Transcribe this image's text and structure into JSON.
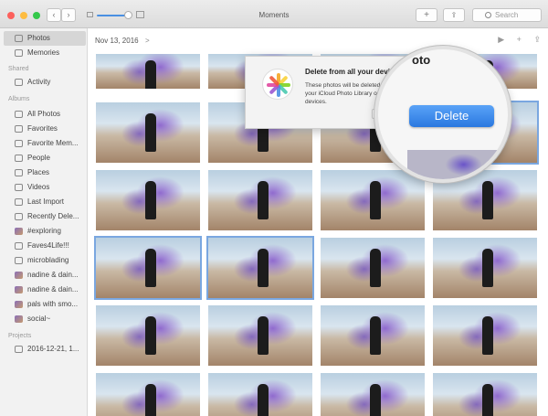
{
  "window": {
    "title": "Moments",
    "search_placeholder": "Search",
    "plus_label": "+",
    "share_label": "⇪"
  },
  "sidebar": {
    "items": [
      {
        "label": "Photos",
        "icon": "photos-icon",
        "selected": true
      },
      {
        "label": "Memories",
        "icon": "memories-icon"
      }
    ],
    "shared_header": "Shared",
    "shared": [
      {
        "label": "Activity",
        "icon": "cloud-icon"
      }
    ],
    "albums_header": "Albums",
    "albums": [
      {
        "label": "All Photos",
        "icon": "album-icon"
      },
      {
        "label": "Favorites",
        "icon": "heart-icon"
      },
      {
        "label": "Favorite Mem...",
        "icon": "heart-icon"
      },
      {
        "label": "People",
        "icon": "person-icon"
      },
      {
        "label": "Places",
        "icon": "pin-icon"
      },
      {
        "label": "Videos",
        "icon": "video-icon"
      },
      {
        "label": "Last Import",
        "icon": "clock-icon"
      },
      {
        "label": "Recently Dele...",
        "icon": "trash-icon"
      },
      {
        "label": "#exploring",
        "icon": "album-thumb-icon"
      },
      {
        "label": "Faves4Life!!!",
        "icon": "album-icon"
      },
      {
        "label": "microblading",
        "icon": "album-icon"
      },
      {
        "label": "nadine & dain...",
        "icon": "album-thumb-icon"
      },
      {
        "label": "nadine & dain...",
        "icon": "album-thumb-icon"
      },
      {
        "label": "pals with smo...",
        "icon": "album-thumb-icon"
      },
      {
        "label": "social~",
        "icon": "album-thumb-icon"
      }
    ],
    "projects_header": "Projects",
    "projects": [
      {
        "label": "2016-12-21, 1...",
        "icon": "project-icon"
      }
    ]
  },
  "main": {
    "date": "Nov 13, 2016",
    "date_chevron": ">",
    "toolbar_icons": [
      "play-icon",
      "plus-icon",
      "share-icon"
    ],
    "toolbar_glyphs": [
      "▶",
      "+",
      "⇪"
    ]
  },
  "dialog": {
    "title": "Delete from all your devices?",
    "message": "These photos will be deleted from your iCloud Photo Library on all your devices.",
    "delete_label": "Delete",
    "magnified_title_fragment": "oto"
  }
}
